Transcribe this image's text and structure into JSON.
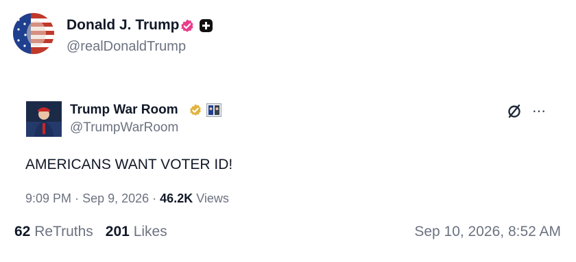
{
  "post": {
    "author_name": "Donald J. Trump",
    "author_handle": "@realDonaldTrump",
    "retruths_count": "62",
    "retruths_label": "ReTruths",
    "likes_count": "201",
    "likes_label": "Likes",
    "date": "Sep 10, 2026, 8:52 AM"
  },
  "quote": {
    "author_name": "Trump War Room",
    "author_handle": "@TrumpWarRoom",
    "text": "AMERICANS WANT VOTER ID!",
    "time": "9:09 PM",
    "date": "Sep 9, 2026",
    "views_count": "46.2K",
    "views_label": "Views"
  },
  "icons": {
    "verified_main": "verified-badge-icon",
    "plus": "plus-badge-icon",
    "verified_quote": "gold-verified-icon",
    "affiliate": "affiliate-badge-icon",
    "no_share": "no-share-icon",
    "more": "more-options-icon"
  },
  "colors": {
    "verified_main": "#e83e8c",
    "verified_quote": "#e2b340",
    "text_primary": "#111827",
    "text_muted": "#6b7280"
  }
}
